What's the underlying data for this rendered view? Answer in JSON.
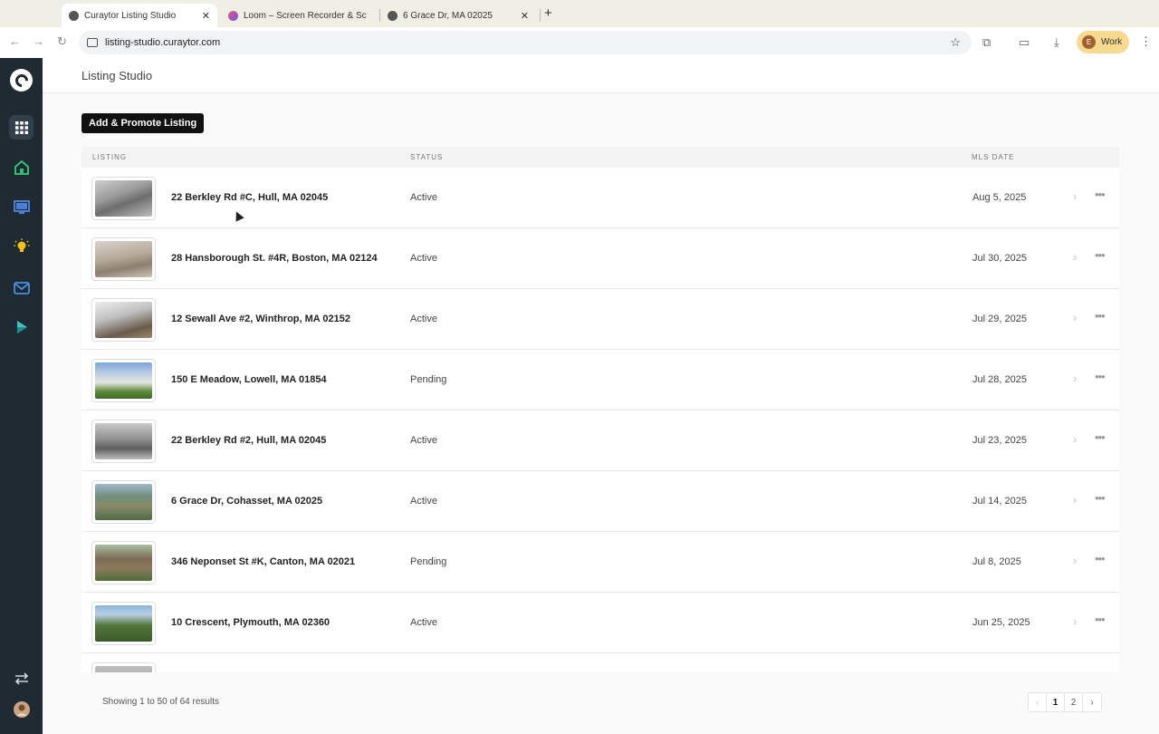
{
  "browser": {
    "tabs": [
      {
        "title": "Curaytor Listing Studio",
        "active": true
      },
      {
        "title": "Loom – Screen Recorder & Sc",
        "active": false
      },
      {
        "title": "6 Grace Dr, MA 02025",
        "active": false
      }
    ],
    "new_tab": "+",
    "url": "listing-studio.curaytor.com",
    "profile_initial": "E",
    "profile_label": "Work"
  },
  "sidebar": {
    "items": [
      {
        "icon": "grid-icon",
        "active": true,
        "color": "#ffffff"
      },
      {
        "icon": "home-icon",
        "active": false,
        "color": "#2fbf71"
      },
      {
        "icon": "monitor-icon",
        "active": false,
        "color": "#4a7fd4"
      },
      {
        "icon": "lightbulb-icon",
        "active": false,
        "color": "#f2c11c"
      },
      {
        "icon": "mail-icon",
        "active": false,
        "color": "#4a8fe0"
      },
      {
        "icon": "play-icon",
        "active": false,
        "color": "#3cc6c6"
      }
    ],
    "bottom": [
      {
        "icon": "swap-icon"
      },
      {
        "icon": "user-avatar-icon"
      }
    ]
  },
  "page": {
    "title": "Listing Studio",
    "add_button": "Add & Promote Listing"
  },
  "table": {
    "columns": {
      "listing": "LISTING",
      "status": "STATUS",
      "mls_date": "MLS DATE"
    },
    "rows": [
      {
        "address": "22 Berkley Rd #C, Hull, MA 02045",
        "status": "Active",
        "date": "Aug 5, 2025"
      },
      {
        "address": "28 Hansborough St. #4R, Boston, MA 02124",
        "status": "Active",
        "date": "Jul 30, 2025"
      },
      {
        "address": "12 Sewall Ave #2, Winthrop, MA 02152",
        "status": "Active",
        "date": "Jul 29, 2025"
      },
      {
        "address": "150 E Meadow, Lowell, MA 01854",
        "status": "Pending",
        "date": "Jul 28, 2025"
      },
      {
        "address": "22 Berkley Rd #2, Hull, MA 02045",
        "status": "Active",
        "date": "Jul 23, 2025"
      },
      {
        "address": "6 Grace Dr, Cohasset, MA 02025",
        "status": "Active",
        "date": "Jul 14, 2025"
      },
      {
        "address": "346 Neponset St #K, Canton, MA 02021",
        "status": "Pending",
        "date": "Jul 8, 2025"
      },
      {
        "address": "10 Crescent, Plymouth, MA 02360",
        "status": "Active",
        "date": "Jun 25, 2025"
      },
      {
        "address": "",
        "status": "",
        "date": ""
      }
    ]
  },
  "footer": {
    "results_text": "Showing 1 to 50 of 64 results",
    "pages": [
      "1",
      "2"
    ],
    "current_page": "1"
  }
}
